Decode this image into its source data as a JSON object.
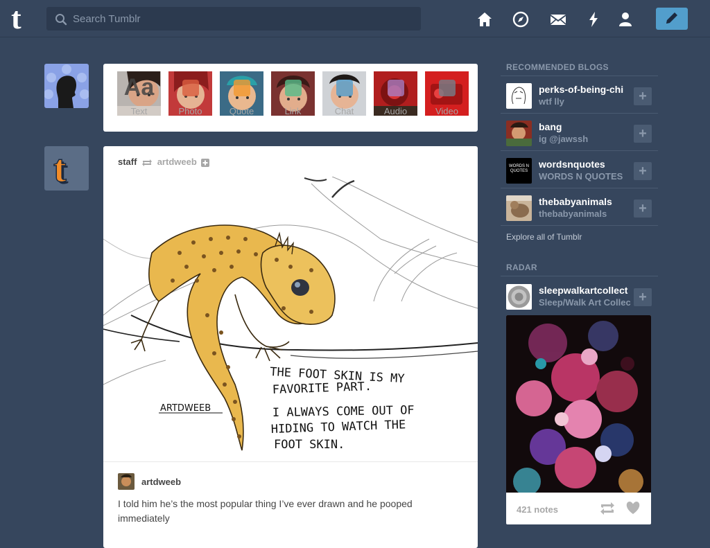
{
  "header": {
    "logo": "t",
    "search_placeholder": "Search Tumblr",
    "nav": [
      {
        "name": "home-icon"
      },
      {
        "name": "explore-icon"
      },
      {
        "name": "inbox-icon"
      },
      {
        "name": "activity-icon"
      },
      {
        "name": "account-icon"
      }
    ],
    "compose_icon": "pencil-icon"
  },
  "post_types": [
    {
      "label": "Text",
      "glyph": "Aa",
      "color": "#444444"
    },
    {
      "label": "Photo",
      "color": "#d95e40"
    },
    {
      "label": "Quote",
      "color": "#f2992e"
    },
    {
      "label": "Link",
      "color": "#56bc8a"
    },
    {
      "label": "Chat",
      "color": "#529ecc"
    },
    {
      "label": "Audio",
      "color": "#a77dc2"
    },
    {
      "label": "Video",
      "color": "#748089"
    }
  ],
  "post": {
    "author": "staff",
    "reblogged_from": "artdweeb",
    "art_text": {
      "signature": "ARTDWEEB",
      "line1": "THE FOOT SKIN IS MY",
      "line2": "FAVORITE PART.",
      "line3": "I ALWAYS COME OUT OF",
      "line4": "HIDING TO WATCH THE",
      "line5": "FOOT SKIN."
    },
    "reblog_user": "artdweeb",
    "caption": "I told him he’s the most popular thing I’ve ever drawn and he pooped immediately"
  },
  "sidebar": {
    "recommended_title": "RECOMMENDED BLOGS",
    "recommended": [
      {
        "name": "perks-of-being-chi",
        "subtitle": "wtf lly"
      },
      {
        "name": "bang",
        "subtitle": "ig @jawssh"
      },
      {
        "name": "wordsnquotes",
        "subtitle": "WORDS N QUOTES",
        "avatar_text": "WORDS N QUOTES"
      },
      {
        "name": "thebabyanimals",
        "subtitle": "thebabyanimals"
      }
    ],
    "explore_link": "Explore all of Tumblr",
    "radar_title": "RADAR",
    "radar": {
      "name": "sleepwalkartcollect",
      "subtitle": "Sleep/Walk Art Collec",
      "notes": "421 notes"
    }
  },
  "colors": {
    "background": "#36465d",
    "accent": "#529ecc"
  }
}
